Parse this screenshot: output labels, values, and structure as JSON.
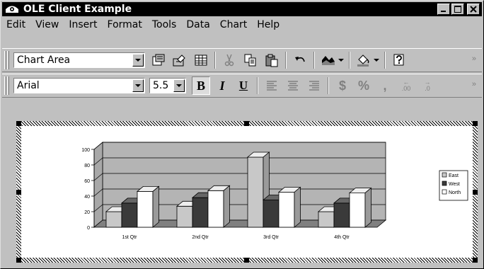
{
  "window": {
    "title": "OLE Client Example"
  },
  "menu": {
    "items": [
      "Edit",
      "View",
      "Insert",
      "Format",
      "Tools",
      "Data",
      "Chart",
      "Help"
    ]
  },
  "toolbar1": {
    "chart_object_value": "Chart Area"
  },
  "toolbar2": {
    "font_value": "Arial",
    "font_size_value": "5.5",
    "bold_label": "B",
    "italic_label": "I",
    "underline_label": "U",
    "currency_label": "$",
    "percent_label": "%",
    "comma_label": ",",
    "inc_decimal_label": ".00",
    "dec_decimal_label": ".0"
  },
  "colors": {
    "east": "#c8c8c8",
    "west": "#3a3a3a",
    "north": "#ffffff",
    "plot_bg": "#b4b4b4",
    "floor": "#808080"
  },
  "chart_data": {
    "type": "bar",
    "categories": [
      "1st Qtr",
      "2nd Qtr",
      "3rd Qtr",
      "4th Qtr"
    ],
    "series": [
      {
        "name": "East",
        "values": [
          20,
          27,
          90,
          20
        ]
      },
      {
        "name": "West",
        "values": [
          31,
          38,
          35,
          31
        ]
      },
      {
        "name": "North",
        "values": [
          46,
          47,
          45,
          44
        ]
      }
    ],
    "ylim": [
      0,
      100
    ],
    "yticks": [
      0,
      20,
      40,
      60,
      80,
      100
    ],
    "grid": true,
    "legend_position": "right",
    "three_d": true
  }
}
